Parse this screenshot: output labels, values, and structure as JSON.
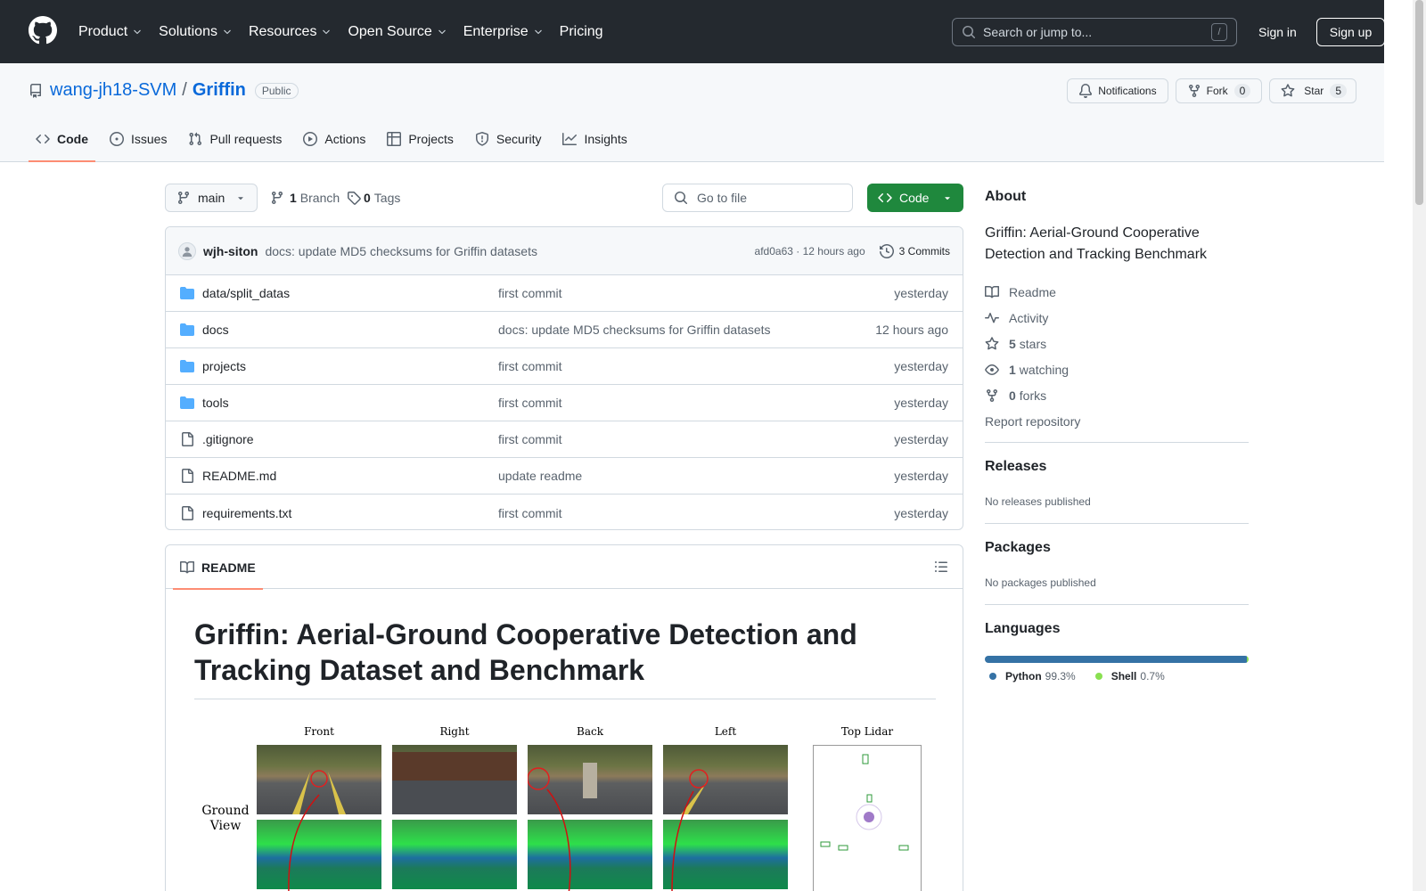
{
  "header": {
    "nav": [
      {
        "label": "Product",
        "dropdown": true
      },
      {
        "label": "Solutions",
        "dropdown": true
      },
      {
        "label": "Resources",
        "dropdown": true
      },
      {
        "label": "Open Source",
        "dropdown": true
      },
      {
        "label": "Enterprise",
        "dropdown": true
      },
      {
        "label": "Pricing",
        "dropdown": false
      }
    ],
    "search_placeholder": "Search or jump to...",
    "search_shortcut": "/",
    "sign_in": "Sign in",
    "sign_up": "Sign up"
  },
  "repo": {
    "owner": "wang-jh18-SVM",
    "separator": "/",
    "name": "Griffin",
    "visibility": "Public",
    "notifications_label": "Notifications",
    "fork_label": "Fork",
    "fork_count": "0",
    "star_label": "Star",
    "star_count": "5",
    "tabs": [
      {
        "label": "Code",
        "icon": "code-icon",
        "active": true
      },
      {
        "label": "Issues",
        "icon": "issue-icon",
        "active": false
      },
      {
        "label": "Pull requests",
        "icon": "pull-request-icon",
        "active": false
      },
      {
        "label": "Actions",
        "icon": "play-icon",
        "active": false
      },
      {
        "label": "Projects",
        "icon": "table-icon",
        "active": false
      },
      {
        "label": "Security",
        "icon": "shield-icon",
        "active": false
      },
      {
        "label": "Insights",
        "icon": "graph-icon",
        "active": false
      }
    ]
  },
  "browser": {
    "branch": "main",
    "branch_count": "1",
    "branch_label": "Branch",
    "tag_count": "0",
    "tag_label": "Tags",
    "goto_placeholder": "Go to file",
    "code_button": "Code",
    "commit": {
      "author": "wjh-siton",
      "message": "docs: update MD5 checksums for Griffin datasets",
      "hash_time": "afd0a63 · 12 hours ago",
      "count_label": "3 Commits"
    },
    "files": [
      {
        "type": "dir",
        "name": "data/split_datas",
        "message": "first commit",
        "date": "yesterday"
      },
      {
        "type": "dir",
        "name": "docs",
        "message": "docs: update MD5 checksums for Griffin datasets",
        "date": "12 hours ago"
      },
      {
        "type": "dir",
        "name": "projects",
        "message": "first commit",
        "date": "yesterday"
      },
      {
        "type": "dir",
        "name": "tools",
        "message": "first commit",
        "date": "yesterday"
      },
      {
        "type": "file",
        "name": ".gitignore",
        "message": "first commit",
        "date": "yesterday"
      },
      {
        "type": "file",
        "name": "README.md",
        "message": "update readme",
        "date": "yesterday"
      },
      {
        "type": "file",
        "name": "requirements.txt",
        "message": "first commit",
        "date": "yesterday"
      }
    ]
  },
  "readme": {
    "tab_label": "README",
    "title": "Griffin: Aerial-Ground Cooperative Detection and Tracking Dataset and Benchmark",
    "figure": {
      "columns": [
        "Front",
        "Right",
        "Back",
        "Left",
        "Top Lidar"
      ],
      "row_label_1": "Ground",
      "row_label_2": "View"
    }
  },
  "sidebar": {
    "about_heading": "About",
    "description": "Griffin: Aerial-Ground Cooperative Detection and Tracking Benchmark",
    "items": [
      {
        "icon": "book-icon",
        "bold": "",
        "text": "Readme"
      },
      {
        "icon": "pulse-icon",
        "bold": "",
        "text": "Activity"
      },
      {
        "icon": "star-icon",
        "bold": "5",
        "text": "stars"
      },
      {
        "icon": "eye-icon",
        "bold": "1",
        "text": "watching"
      },
      {
        "icon": "fork-icon",
        "bold": "0",
        "text": "forks"
      }
    ],
    "report": "Report repository",
    "releases_heading": "Releases",
    "releases_text": "No releases published",
    "packages_heading": "Packages",
    "packages_text": "No packages published",
    "languages_heading": "Languages",
    "languages": [
      {
        "name": "Python",
        "percent": "99.3%",
        "share": 99.3,
        "color": "#3572A5"
      },
      {
        "name": "Shell",
        "percent": "0.7%",
        "share": 0.7,
        "color": "#89e051"
      }
    ]
  }
}
